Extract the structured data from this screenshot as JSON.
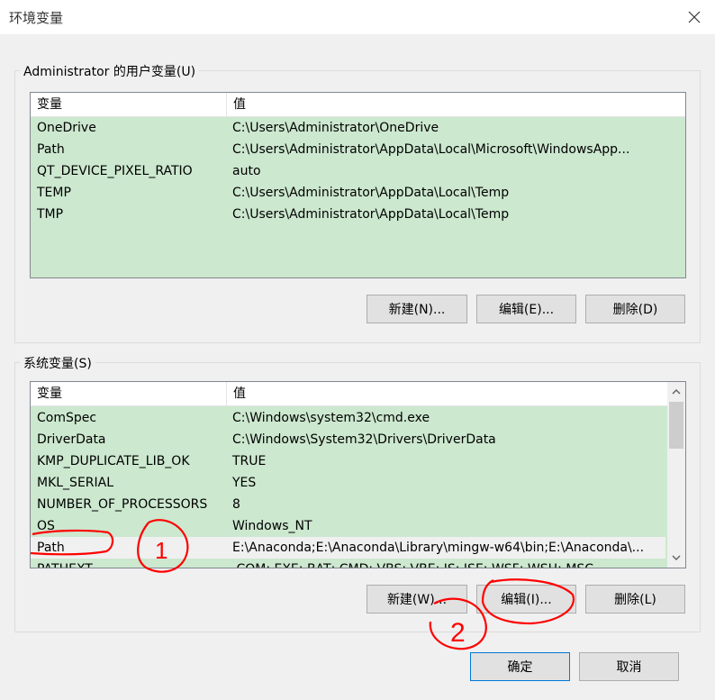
{
  "window": {
    "title": "环境变量",
    "close_icon": "close-icon"
  },
  "user_vars": {
    "group_label": "Administrator 的用户变量(U)",
    "columns": [
      "变量",
      "值"
    ],
    "rows": [
      {
        "name": "OneDrive",
        "value": "C:\\Users\\Administrator\\OneDrive"
      },
      {
        "name": "Path",
        "value": "C:\\Users\\Administrator\\AppData\\Local\\Microsoft\\WindowsApp..."
      },
      {
        "name": "QT_DEVICE_PIXEL_RATIO",
        "value": "auto"
      },
      {
        "name": "TEMP",
        "value": "C:\\Users\\Administrator\\AppData\\Local\\Temp"
      },
      {
        "name": "TMP",
        "value": "C:\\Users\\Administrator\\AppData\\Local\\Temp"
      }
    ],
    "buttons": {
      "new": "新建(N)...",
      "edit": "编辑(E)...",
      "delete": "删除(D)"
    }
  },
  "system_vars": {
    "group_label": "系统变量(S)",
    "columns": [
      "变量",
      "值"
    ],
    "rows": [
      {
        "name": "ComSpec",
        "value": "C:\\Windows\\system32\\cmd.exe"
      },
      {
        "name": "DriverData",
        "value": "C:\\Windows\\System32\\Drivers\\DriverData"
      },
      {
        "name": "KMP_DUPLICATE_LIB_OK",
        "value": "TRUE"
      },
      {
        "name": "MKL_SERIAL",
        "value": "YES"
      },
      {
        "name": "NUMBER_OF_PROCESSORS",
        "value": "8"
      },
      {
        "name": "OS",
        "value": "Windows_NT"
      },
      {
        "name": "Path",
        "value": "E:\\Anaconda;E:\\Anaconda\\Library\\mingw-w64\\bin;E:\\Anaconda\\..."
      },
      {
        "name": "PATHEXT",
        "value": ".COM;.EXE;.BAT;.CMD;.VBS;.VBE;.JS;.JSE;.WSF;.WSH;.MSC"
      }
    ],
    "selected_index": 6,
    "buttons": {
      "new": "新建(W)...",
      "edit": "编辑(I)...",
      "delete": "删除(L)"
    }
  },
  "footer": {
    "ok": "确定",
    "cancel": "取消"
  },
  "annotations": {
    "marker_1": "1",
    "marker_2": "2"
  },
  "colors": {
    "list_bg": "#cce8cf",
    "annotation": "#ff0000"
  }
}
